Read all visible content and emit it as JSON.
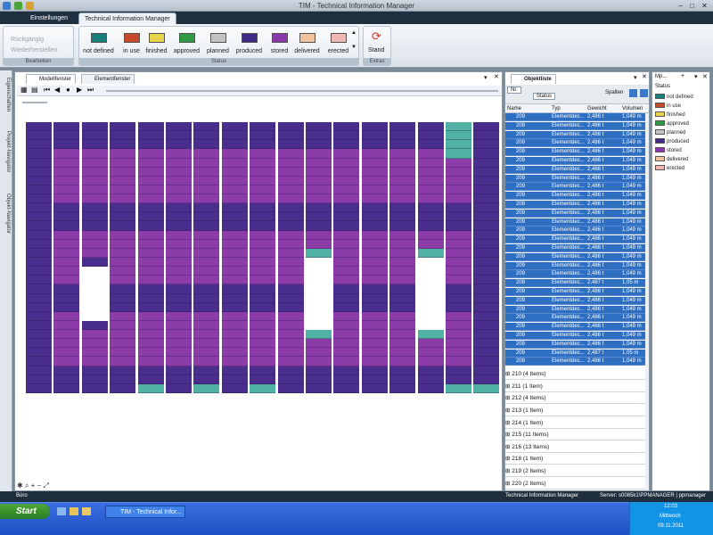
{
  "window": {
    "title": "TIM - Technical Information Manager"
  },
  "ribbon": {
    "tabs": [
      "Einstellungen",
      "Technical Information Manager"
    ],
    "edit_group": {
      "undo": "Rückgängig",
      "redo": "Wiederherstellen",
      "label": "Bearbeiten"
    },
    "status_group": {
      "label": "Status",
      "buttons": [
        {
          "label": "not defined",
          "color": "#1a7f7a"
        },
        {
          "label": "in use",
          "color": "#c64b2c"
        },
        {
          "label": "finished",
          "color": "#e7d44a"
        },
        {
          "label": "approved",
          "color": "#2f9a45"
        },
        {
          "label": "planned",
          "color": "#c3c3c3"
        },
        {
          "label": "produced",
          "color": "#3f2a86"
        },
        {
          "label": "stored",
          "color": "#8a3aa8"
        },
        {
          "label": "delivered",
          "color": "#efc39f"
        },
        {
          "label": "erected",
          "color": "#f1b7b4"
        }
      ]
    },
    "extras_group": {
      "button": "Stand",
      "label": "Extras"
    }
  },
  "left_strip": {
    "tabs": [
      "Eigenschaften",
      "Projekt-Navigator",
      "Objekt-Navigator"
    ]
  },
  "model_window": {
    "tabs": [
      "Modellfenster",
      "Elementfenster"
    ],
    "grid_colors": {
      "produced": "#4a2e8e",
      "stored": "#8c3ca8",
      "green": "#4fb2a4"
    }
  },
  "object_list": {
    "tab": "Objektliste",
    "filter_nr": "Nr.",
    "filter_status": "Status",
    "columns_button": "Spalten",
    "headers": [
      "Name",
      "Typ",
      "Gewicht",
      "Volumen"
    ],
    "rows": [
      {
        "name": "209",
        "typ": "Elementdec...",
        "gewicht": "2,486 t",
        "volumen": "1,049 m"
      },
      {
        "name": "209",
        "typ": "Elementdec...",
        "gewicht": "2,486 t",
        "volumen": "1,049 m"
      },
      {
        "name": "209",
        "typ": "Elementdec...",
        "gewicht": "2,486 t",
        "volumen": "1,049 m"
      },
      {
        "name": "209",
        "typ": "Elementdec...",
        "gewicht": "2,486 t",
        "volumen": "1,049 m"
      },
      {
        "name": "209",
        "typ": "Elementdec...",
        "gewicht": "2,486 t",
        "volumen": "1,049 m"
      },
      {
        "name": "209",
        "typ": "Elementdec...",
        "gewicht": "2,486 t",
        "volumen": "1,049 m"
      },
      {
        "name": "209",
        "typ": "Elementdec...",
        "gewicht": "2,486 t",
        "volumen": "1,049 m"
      },
      {
        "name": "209",
        "typ": "Elementdec...",
        "gewicht": "2,486 t",
        "volumen": "1,049 m"
      },
      {
        "name": "209",
        "typ": "Elementdec...",
        "gewicht": "2,486 t",
        "volumen": "1,049 m"
      },
      {
        "name": "209",
        "typ": "Elementdec...",
        "gewicht": "2,486 t",
        "volumen": "1,049 m"
      },
      {
        "name": "209",
        "typ": "Elementdec...",
        "gewicht": "2,486 t",
        "volumen": "1,049 m"
      },
      {
        "name": "209",
        "typ": "Elementdec...",
        "gewicht": "2,486 t",
        "volumen": "1,049 m"
      },
      {
        "name": "209",
        "typ": "Elementdec...",
        "gewicht": "2,486 t",
        "volumen": "1,049 m"
      },
      {
        "name": "209",
        "typ": "Elementdec...",
        "gewicht": "2,486 t",
        "volumen": "1,049 m"
      },
      {
        "name": "209",
        "typ": "Elementdec...",
        "gewicht": "2,486 t",
        "volumen": "1,049 m"
      },
      {
        "name": "209",
        "typ": "Elementdec...",
        "gewicht": "2,486 t",
        "volumen": "1,049 m"
      },
      {
        "name": "209",
        "typ": "Elementdec...",
        "gewicht": "2,486 t",
        "volumen": "1,049 m"
      },
      {
        "name": "209",
        "typ": "Elementdec...",
        "gewicht": "2,486 t",
        "volumen": "1,049 m"
      },
      {
        "name": "209",
        "typ": "Elementdec...",
        "gewicht": "2,486 t",
        "volumen": "1,049 m"
      },
      {
        "name": "209",
        "typ": "Elementdec...",
        "gewicht": "2,487 t",
        "volumen": "1,05 m"
      },
      {
        "name": "209",
        "typ": "Elementdec...",
        "gewicht": "2,486 t",
        "volumen": "1,049 m"
      },
      {
        "name": "209",
        "typ": "Elementdec...",
        "gewicht": "2,486 t",
        "volumen": "1,049 m"
      },
      {
        "name": "209",
        "typ": "Elementdec...",
        "gewicht": "2,486 t",
        "volumen": "1,049 m"
      },
      {
        "name": "209",
        "typ": "Elementdec...",
        "gewicht": "2,486 t",
        "volumen": "1,049 m"
      },
      {
        "name": "209",
        "typ": "Elementdec...",
        "gewicht": "2,486 t",
        "volumen": "1,049 m"
      },
      {
        "name": "209",
        "typ": "Elementdec...",
        "gewicht": "2,486 t",
        "volumen": "1,049 m"
      },
      {
        "name": "209",
        "typ": "Elementdec...",
        "gewicht": "2,486 t",
        "volumen": "1,049 m"
      },
      {
        "name": "209",
        "typ": "Elementdec...",
        "gewicht": "2,487 t",
        "volumen": "1,05 m"
      },
      {
        "name": "209",
        "typ": "Elementdec...",
        "gewicht": "2,486 t",
        "volumen": "1,049 m"
      }
    ],
    "groups": [
      "210 (4 Items)",
      "211 (1 Item)",
      "212 (4 Items)",
      "213 (1 Item)",
      "214 (1 Item)",
      "215 (11 Items)",
      "216 (13 Items)",
      "218 (1 Item)",
      "219 (2 Items)",
      "220 (2 Items)"
    ]
  },
  "status_panel": {
    "title": "Mp...",
    "header": "Status",
    "items": [
      {
        "label": "not defined",
        "color": "#1a7f7a"
      },
      {
        "label": "in use",
        "color": "#c64b2c"
      },
      {
        "label": "finished",
        "color": "#e7d44a"
      },
      {
        "label": "approved",
        "color": "#2f9a45"
      },
      {
        "label": "planned",
        "color": "#c3c3c3"
      },
      {
        "label": "produced",
        "color": "#3f2a86"
      },
      {
        "label": "stored",
        "color": "#8a3aa8"
      },
      {
        "label": "delivered",
        "color": "#efc39f"
      },
      {
        "label": "erected",
        "color": "#f1b7b4"
      }
    ]
  },
  "statusbar": {
    "left": "Büro",
    "app": "Technical Information Manager",
    "server": "Server: s0085k1\\PPMANAGER | ppmanager"
  },
  "taskbar": {
    "start": "Start",
    "item": "TIM - Technical Infor...",
    "time": "12:03",
    "day": "Mittwoch",
    "date": "09.11.2011"
  }
}
